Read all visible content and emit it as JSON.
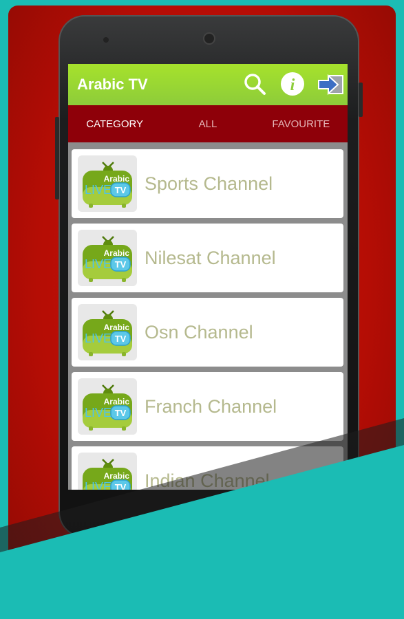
{
  "app": {
    "title": "Arabic TV",
    "icons": [
      "search-icon",
      "info-icon",
      "exit-icon"
    ]
  },
  "tabs": [
    {
      "label": "CATEGORY",
      "active": true
    },
    {
      "label": "ALL",
      "active": false
    },
    {
      "label": "FAVOURITE",
      "active": false
    }
  ],
  "logo": {
    "line1": "Arabic",
    "line2": "LIVE",
    "line3": "TV"
  },
  "channels": [
    {
      "name": "Sports Channel"
    },
    {
      "name": "Nilesat Channel"
    },
    {
      "name": "Osn Channel"
    },
    {
      "name": "Franch Channel"
    },
    {
      "name": "Indian Channel"
    }
  ],
  "colors": {
    "toolbar": "#9ad631",
    "tabs": "#8e0009",
    "background": "#1bbcb4",
    "red": "#c40f06"
  }
}
